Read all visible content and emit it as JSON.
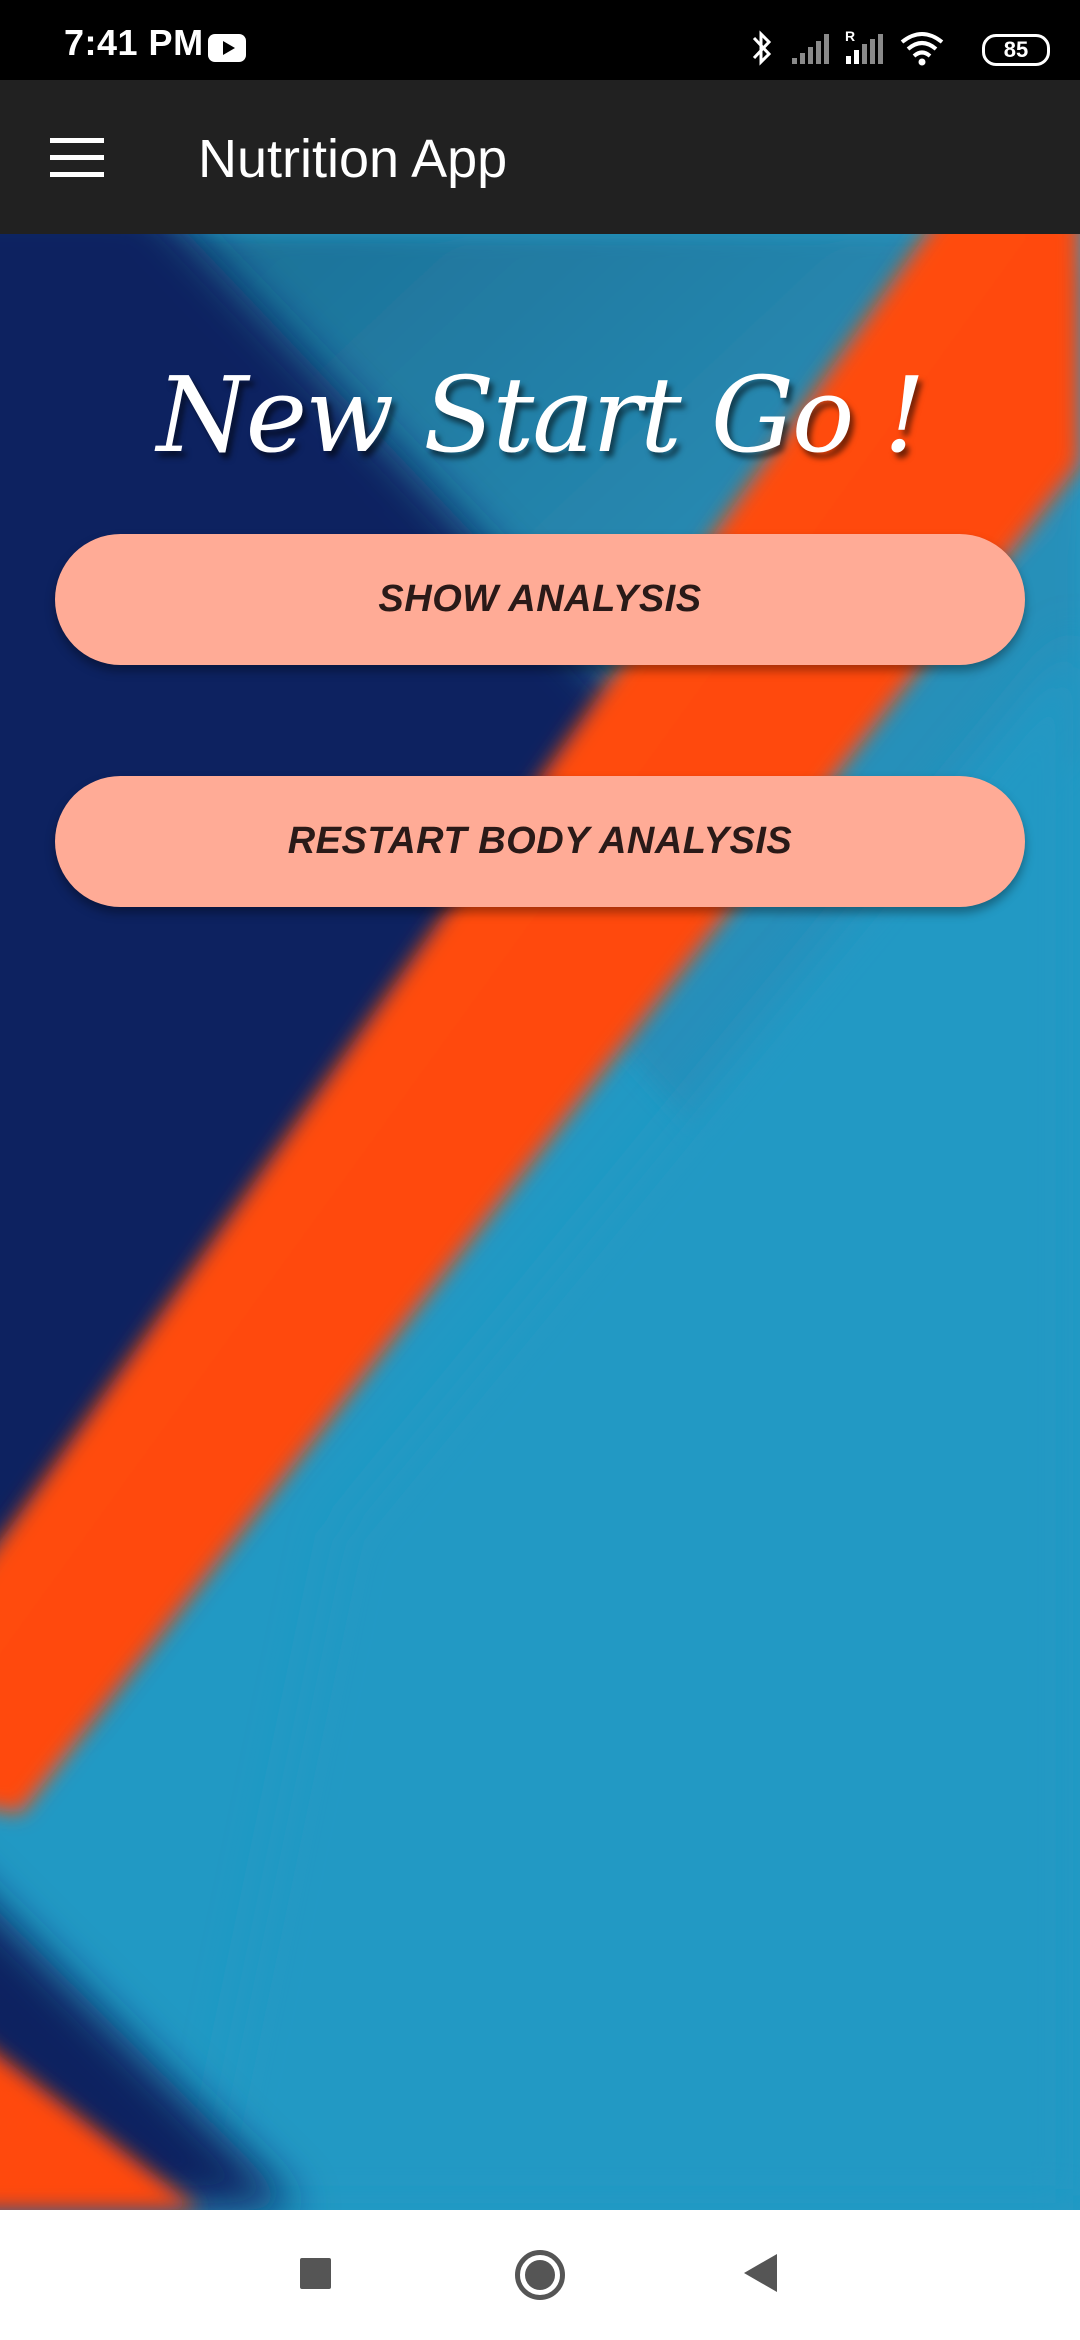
{
  "status_bar": {
    "time": "7:41 PM",
    "battery": "85",
    "icons": [
      "youtube-icon",
      "bluetooth-icon",
      "signal-icon",
      "roaming-signal-icon",
      "wifi-icon",
      "battery-icon"
    ]
  },
  "app_bar": {
    "title": "Nutrition App",
    "menu_icon": "hamburger-menu-icon"
  },
  "main": {
    "headline": "New Start Go !",
    "buttons": {
      "show_analysis": "SHOW ANALYSIS",
      "restart_body_analysis": "RESTART BODY ANALYSIS"
    }
  },
  "nav_bar": {
    "icons": [
      "recents-icon",
      "home-icon",
      "back-icon"
    ]
  },
  "colors": {
    "status_bar": "#000000",
    "app_bar": "#212121",
    "button_fill": "#ffab96",
    "button_text": "#2a1a18",
    "background_blue": "#2199c4",
    "background_navy": "#0b2160",
    "background_orange": "#ff4a0a"
  }
}
